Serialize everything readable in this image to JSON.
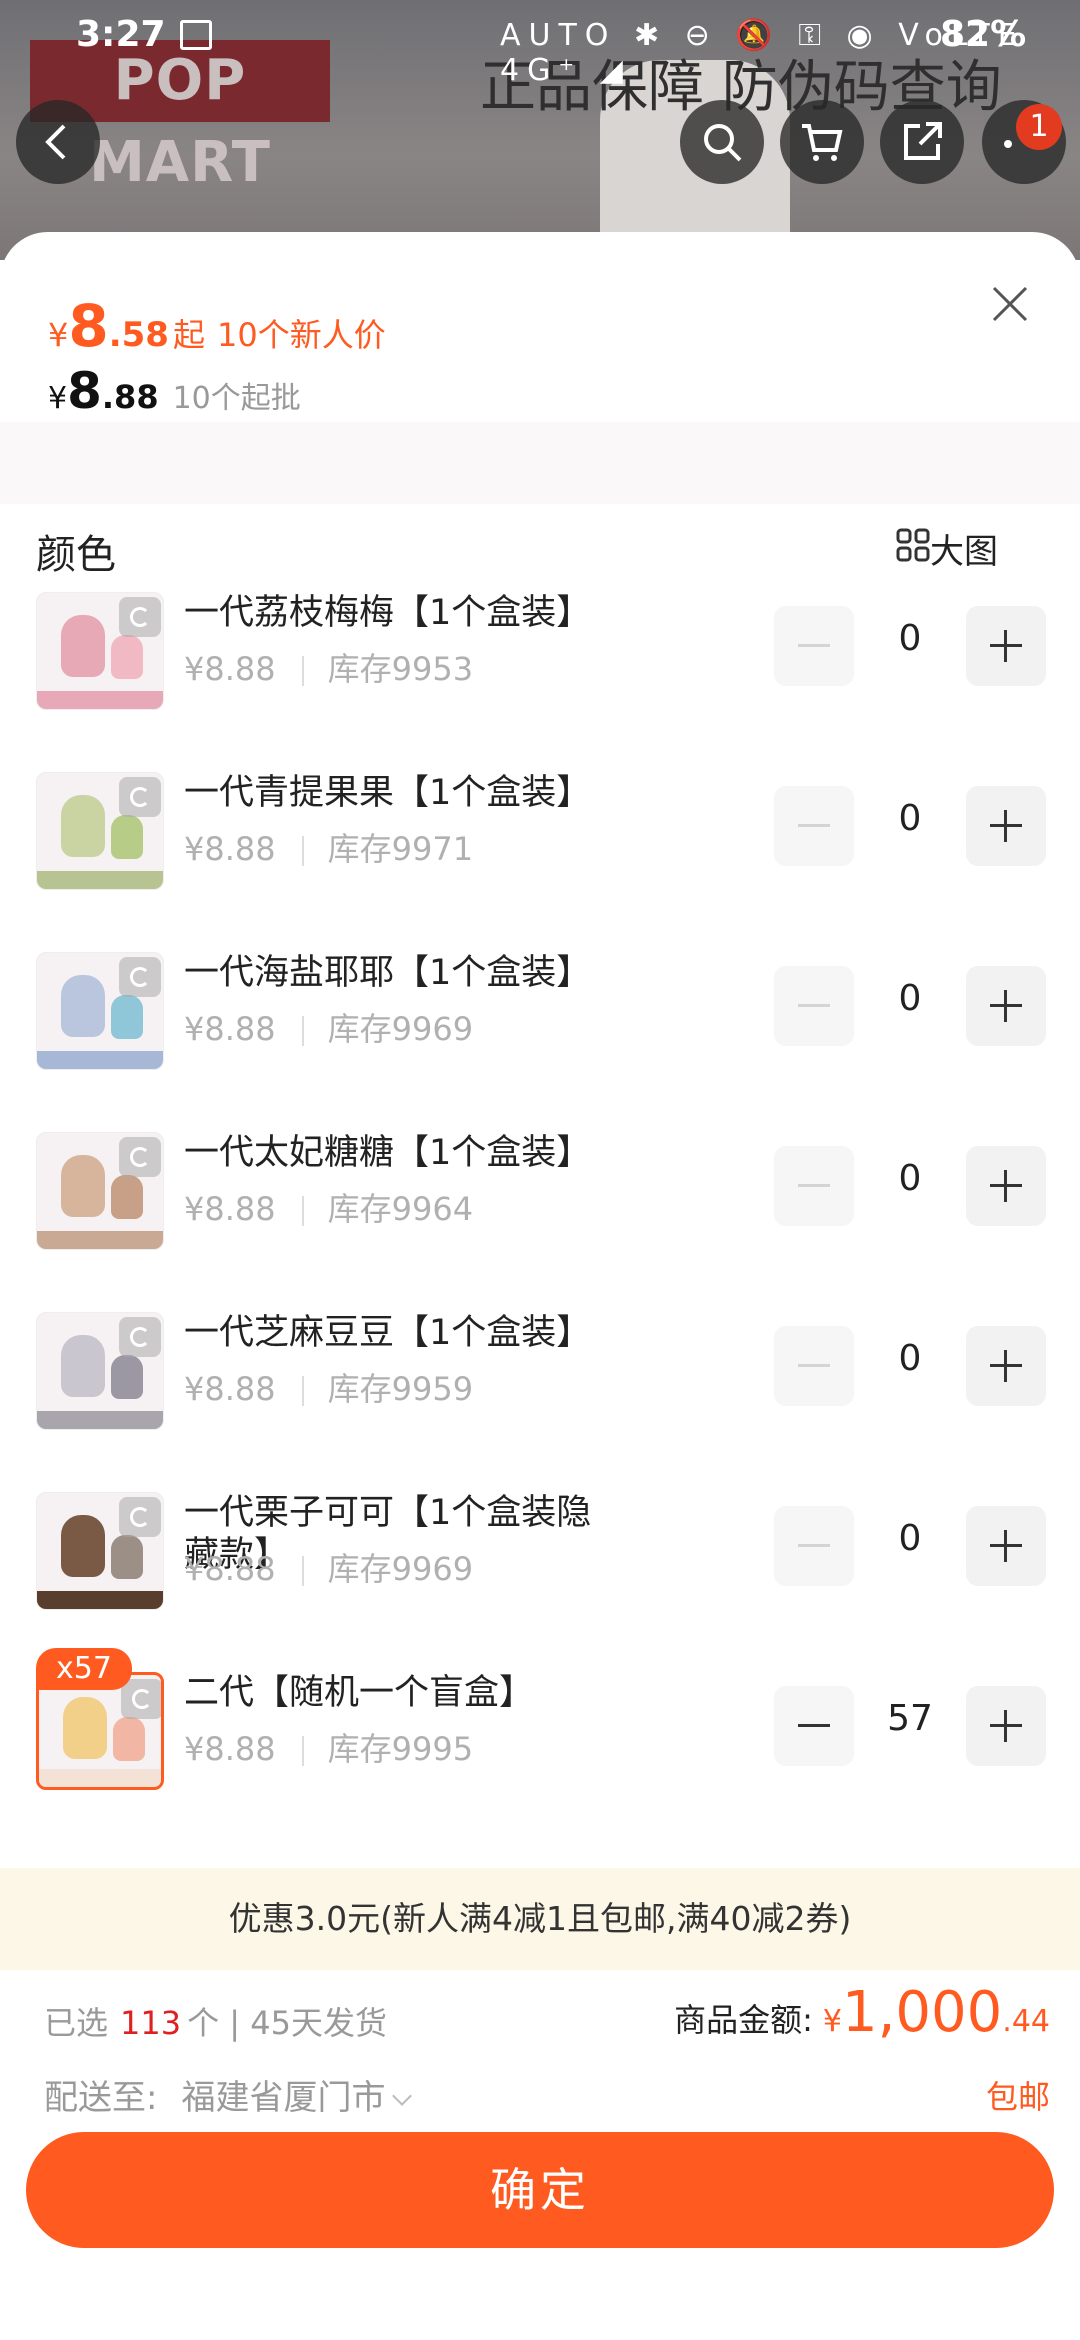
{
  "status_bar": {
    "time": "3:27",
    "icons": "AUTO ✱ ⊖ 🔕 ⚿ ◉ VoLTE 4G⁺ ◢",
    "battery": "82%"
  },
  "background": {
    "brand": "POP MART",
    "banner": "正品保障  防伪码查询",
    "cart_count": "1"
  },
  "header": {
    "price_new": {
      "currency": "¥",
      "int": "8",
      "dec": ".58",
      "suffix": "起",
      "tag": "10个新人价"
    },
    "price_bulk": {
      "currency": "¥",
      "int": "8",
      "dec": ".88",
      "tag": "10个起批"
    }
  },
  "section": {
    "title": "颜色",
    "big_image_label": "大图"
  },
  "items": [
    {
      "name": "一代荔枝梅梅【1个盒装】",
      "price": "¥8.88",
      "stock": "库存9953",
      "qty": "0",
      "color": "#e8a9b6",
      "color2": "#f1b9c4",
      "floor": "#e7a9b7"
    },
    {
      "name": "一代青提果果【1个盒装】",
      "price": "¥8.88",
      "stock": "库存9971",
      "qty": "0",
      "color": "#c9d4a2",
      "color2": "#b7cc86",
      "floor": "#b8c392"
    },
    {
      "name": "一代海盐耶耶【1个盒装】",
      "price": "¥8.88",
      "stock": "库存9969",
      "qty": "0",
      "color": "#b9c6de",
      "color2": "#8fc7d8",
      "floor": "#a7b8d6"
    },
    {
      "name": "一代太妃糖糖【1个盒装】",
      "price": "¥8.88",
      "stock": "库存9964",
      "qty": "0",
      "color": "#d7b59d",
      "color2": "#c8a088",
      "floor": "#c9a993"
    },
    {
      "name": "一代芝麻豆豆【1个盒装】",
      "price": "¥8.88",
      "stock": "库存9959",
      "qty": "0",
      "color": "#c9c6cf",
      "color2": "#9b98a3",
      "floor": "#a8a5ad"
    },
    {
      "name": "一代栗子可可【1个盒装隐藏款】",
      "price": "¥8.88",
      "stock": "库存9969",
      "qty": "0",
      "color": "#7a5a44",
      "color2": "#9b8f86",
      "floor": "#5a3e2d"
    },
    {
      "name": "二代【随机一个盲盒】",
      "price": "¥8.88",
      "stock": "库存9995",
      "qty": "57",
      "badge": "x57",
      "selected": true,
      "color": "#f2d089",
      "color2": "#f1b6a4",
      "floor": "#f4e2d6"
    }
  ],
  "coupon": "优惠3.0元(新人满4减1且包邮,满40减2券)",
  "summary": {
    "selected_prefix": "已选",
    "selected_count": "113",
    "selected_suffix": "个 | 45天发货",
    "amount_label": "商品金额:",
    "amount_currency": "¥",
    "amount_int": "1,000",
    "amount_dec": ".44",
    "ship_label": "配送至:",
    "ship_address": "福建省厦门市",
    "free_shipping": "包邮"
  },
  "confirm_label": "确定",
  "colors": {
    "accent": "#ff5a1f",
    "count_red": "#e02020",
    "coupon_bg": "#fdf7e8"
  }
}
